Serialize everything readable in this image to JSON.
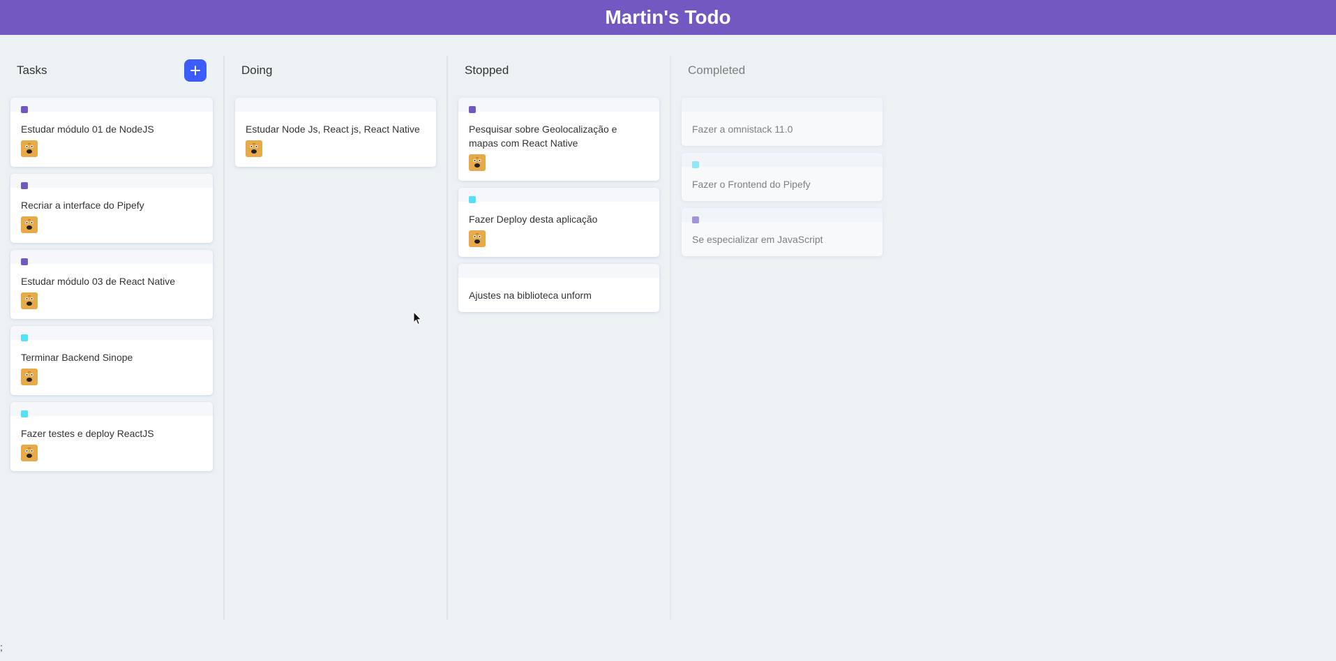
{
  "app": {
    "title": "Martin's Todo"
  },
  "colors": {
    "header": "#7159c1",
    "add_button": "#3b5bfd",
    "label_purple": "#7159c1",
    "label_cyan": "#54e1f7"
  },
  "lists": [
    {
      "title": "Tasks",
      "has_add_button": true,
      "add_icon": "plus-icon",
      "cards": [
        {
          "content": "Estudar módulo 01 de NodeJS",
          "label": "#7159c1",
          "avatar": true
        },
        {
          "content": "Recriar a interface do Pipefy",
          "label": "#7159c1",
          "avatar": true
        },
        {
          "content": "Estudar módulo 03 de React Native",
          "label": "#7159c1",
          "avatar": true
        },
        {
          "content": "Terminar Backend Sinope",
          "label": "#54e1f7",
          "avatar": true
        },
        {
          "content": "Fazer testes e deploy ReactJS",
          "label": "#54e1f7",
          "avatar": true
        }
      ]
    },
    {
      "title": "Doing",
      "cards": [
        {
          "content": "Estudar Node Js, React js, React Native",
          "label": null,
          "avatar": true
        }
      ]
    },
    {
      "title": "Stopped",
      "cards": [
        {
          "content": "Pesquisar sobre Geolocalização e mapas com React Native",
          "label": "#7159c1",
          "avatar": true
        },
        {
          "content": "Fazer Deploy desta aplicação",
          "label": "#54e1f7",
          "avatar": true
        },
        {
          "content": "Ajustes na biblioteca unform",
          "label": null,
          "avatar": false
        }
      ]
    },
    {
      "title": "Completed",
      "done": true,
      "cards": [
        {
          "content": "Fazer a omnistack 11.0",
          "label": null,
          "avatar": false
        },
        {
          "content": "Fazer o Frontend do Pipefy",
          "label": "#54e1f7",
          "avatar": false
        },
        {
          "content": "Se especializar em JavaScript",
          "label": "#7159c1",
          "avatar": false
        }
      ]
    }
  ],
  "corner_mark": ";"
}
